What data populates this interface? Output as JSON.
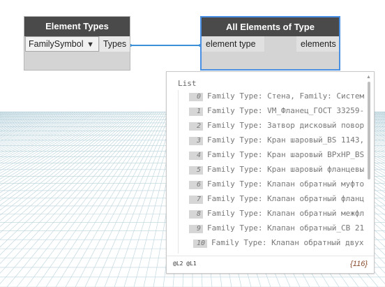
{
  "nodes": {
    "element_types": {
      "title": "Element Types",
      "dropdown_value": "FamilySymbol",
      "output_port": "Types"
    },
    "all_elements": {
      "title": "All Elements of Type",
      "input_port": "element type",
      "output_port": "elements"
    }
  },
  "preview": {
    "list_label": "List",
    "rows": [
      {
        "index": "0",
        "text": "Family Type: Стена, Family: Систем"
      },
      {
        "index": "1",
        "text": "Family Type: VM_Фланец_ГОСТ 33259-"
      },
      {
        "index": "2",
        "text": "Family Type: Затвор дисковый повор"
      },
      {
        "index": "3",
        "text": "Family Type: Кран шаровый_BS 1143,"
      },
      {
        "index": "4",
        "text": "Family Type: Кран шаровый ВРхНР_BS"
      },
      {
        "index": "5",
        "text": "Family Type: Кран шаровый фланцевы"
      },
      {
        "index": "6",
        "text": "Family Type: Клапан обратный муфто"
      },
      {
        "index": "7",
        "text": "Family Type: Клапан обратный фланц"
      },
      {
        "index": "8",
        "text": "Family Type: Клапан обратный межфл"
      },
      {
        "index": "9",
        "text": "Family Type: Клапан обратный_СВ 21"
      },
      {
        "index": "10",
        "text": "Family Type: Клапан обратный двух"
      }
    ],
    "levels": "@L2 @L1",
    "count": "{116}"
  },
  "colors": {
    "node_header": "#4a4a4a",
    "node_body": "#d4d4d4",
    "selection": "#4a90e2",
    "wire": "#3a8fd6",
    "count": "#8a4b2d"
  }
}
